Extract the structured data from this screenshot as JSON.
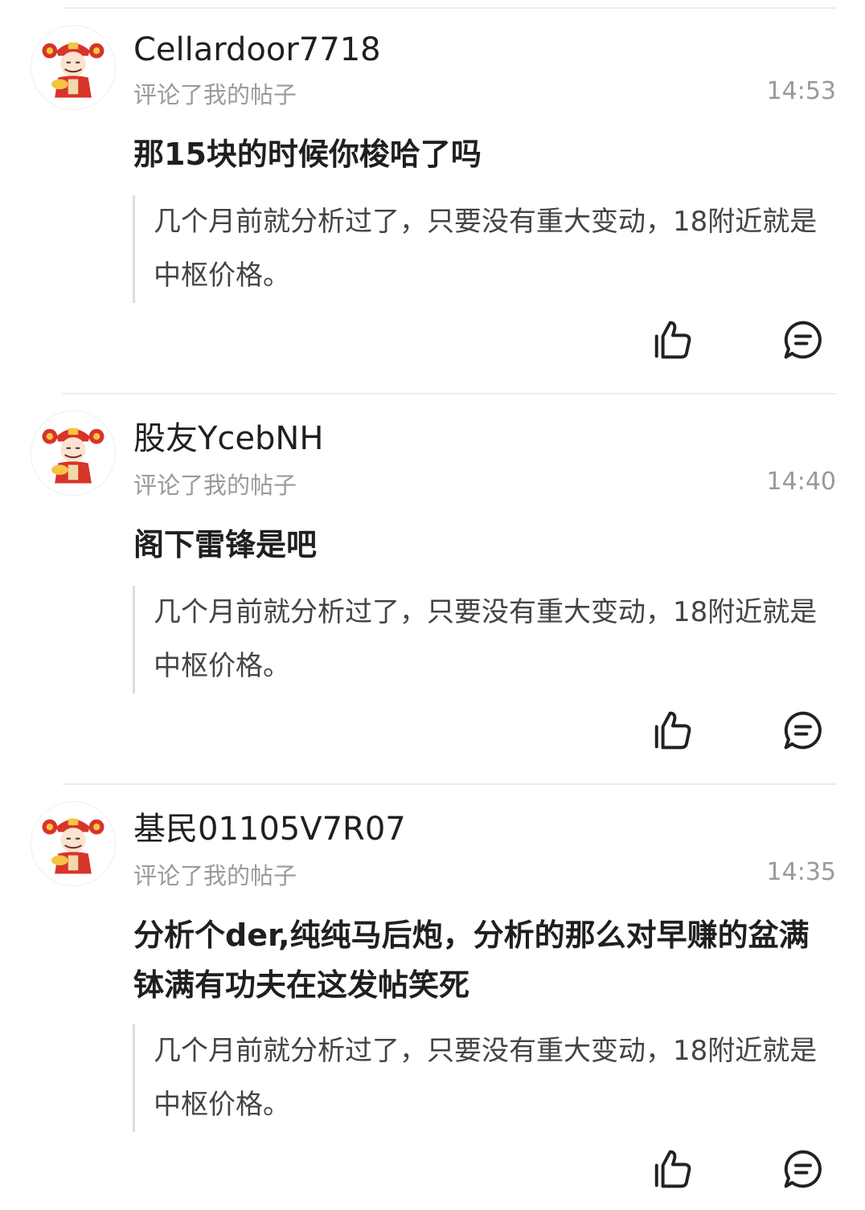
{
  "comments": [
    {
      "username": "Cellardoor7718",
      "action": "评论了我的帖子",
      "time": "14:53",
      "text": "那15块的时候你梭哈了吗",
      "quote": "几个月前就分析过了，只要没有重大变动，18附近就是中枢价格。"
    },
    {
      "username": "股友YcebNH",
      "action": "评论了我的帖子",
      "time": "14:40",
      "text": "阁下雷锋是吧",
      "quote": "几个月前就分析过了，只要没有重大变动，18附近就是中枢价格。"
    },
    {
      "username": "基民01105V7R07",
      "action": "评论了我的帖子",
      "time": "14:35",
      "text": "分析个der,纯纯马后炮，分析的那么对早赚的盆满钵满有功夫在这发帖笑死",
      "quote": "几个月前就分析过了，只要没有重大变动，18附近就是中枢价格。"
    }
  ],
  "icons": {
    "like": "thumbs-up-icon",
    "reply": "comment-bubble-icon",
    "avatar": "god-of-wealth-avatar"
  },
  "colors": {
    "text": "#1f1f1f",
    "meta": "#9a9a9a",
    "quote_bar": "#dcdcdc",
    "divider": "#ececec"
  }
}
